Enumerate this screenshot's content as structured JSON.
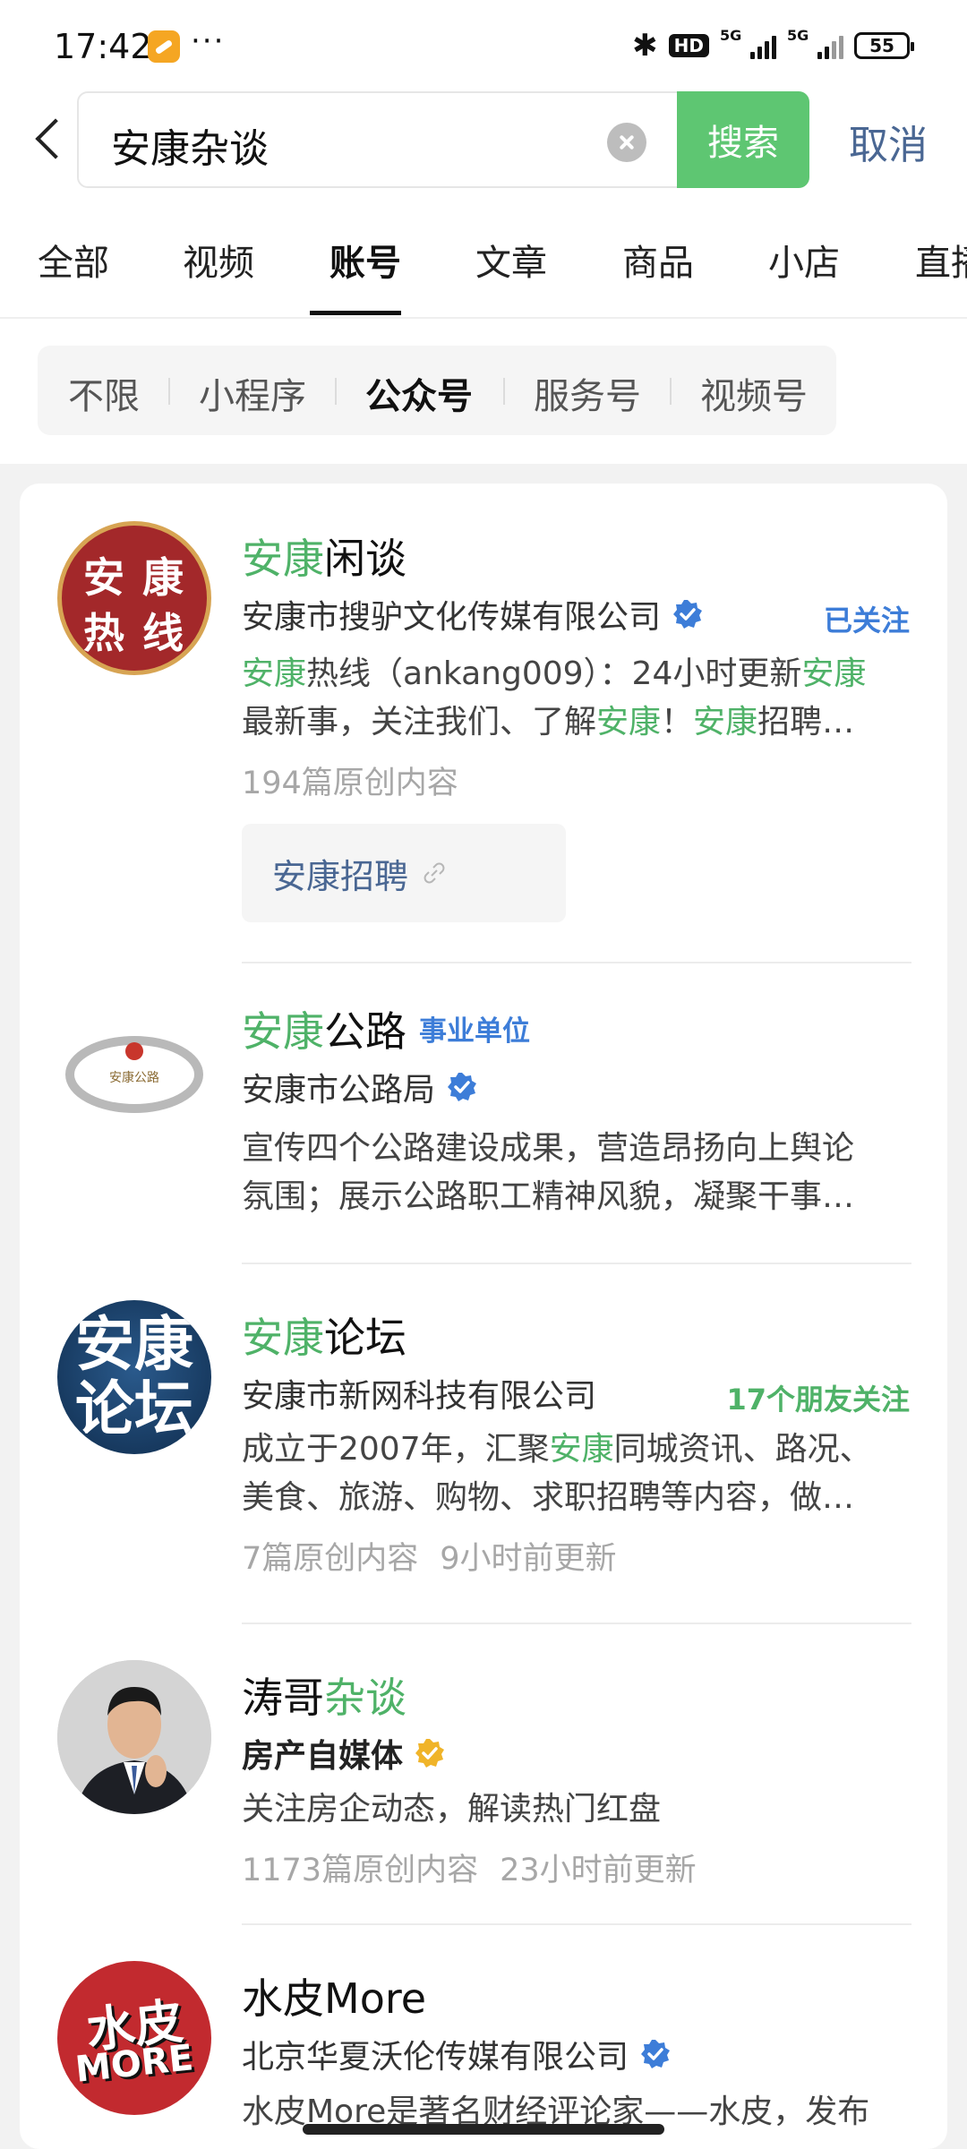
{
  "status_bar": {
    "time": "17:42",
    "dots": "···",
    "bluetooth_glyph": "✱",
    "hd_label": "HD",
    "signal1_label": "5G",
    "signal2_label": "5G",
    "battery": "55"
  },
  "search": {
    "query": "安康杂谈",
    "button_label": "搜索",
    "cancel_label": "取消"
  },
  "tabs": [
    "全部",
    "视频",
    "账号",
    "文章",
    "商品",
    "小店",
    "直播"
  ],
  "active_tab": "账号",
  "filters": [
    "不限",
    "小程序",
    "公众号",
    "服务号",
    "视频号"
  ],
  "active_filter": "公众号",
  "results": [
    {
      "name_hl": "安康",
      "name_rest": "闲谈",
      "avatar_text_1": "安 康",
      "avatar_text_2": "热 线",
      "org": "安康市搜驴文化传媒有限公司",
      "side_link": "已关注",
      "desc_line1": [
        {
          "t": "安康",
          "hl": true
        },
        {
          "t": "热线（ankang009）：24小时更新",
          "hl": false
        },
        {
          "t": "安康",
          "hl": true
        }
      ],
      "desc_line2": [
        {
          "t": "最新事，关注我们、了解",
          "hl": false
        },
        {
          "t": "安康",
          "hl": true
        },
        {
          "t": "！",
          "hl": false
        },
        {
          "t": "安康",
          "hl": true
        },
        {
          "t": "招聘…",
          "hl": false
        }
      ],
      "meta": [
        "194篇原创内容"
      ],
      "link_card": "安康招聘"
    },
    {
      "name_hl": "安康",
      "name_rest": "公路",
      "tag": "事业单位",
      "avatar_text_1": "安康公路",
      "org": "安康市公路局",
      "desc_line1": [
        {
          "t": "宣传四个公路建设成果，营造昂扬向上舆论",
          "hl": false
        }
      ],
      "desc_line2": [
        {
          "t": "氛围；展示公路职工精神风貌，凝聚干事…",
          "hl": false
        }
      ]
    },
    {
      "name_hl": "安康",
      "name_rest": "论坛",
      "avatar_text_1": "安康",
      "avatar_text_2": "论坛",
      "org": "安康市新网科技有限公司",
      "side_link": "17个朋友关注",
      "desc_line1": [
        {
          "t": "成立于2007年，汇聚",
          "hl": false
        },
        {
          "t": "安康",
          "hl": true
        },
        {
          "t": "同城资讯、路况、",
          "hl": false
        }
      ],
      "desc_line2": [
        {
          "t": "美食、旅游、购物、求职招聘等内容，做…",
          "hl": false
        }
      ],
      "meta": [
        "7篇原创内容",
        "9小时前更新"
      ]
    },
    {
      "name_plain": "涛哥",
      "name_hl": "杂谈",
      "org": "房产自媒体",
      "desc_line1": [
        {
          "t": "关注房企动态，解读热门红盘",
          "hl": false
        }
      ],
      "meta": [
        "1173篇原创内容",
        "23小时前更新"
      ]
    },
    {
      "name_plain": "水皮More",
      "avatar_text_1": "水皮",
      "avatar_text_2": "MORE",
      "org": "北京华夏沃伦传媒有限公司",
      "desc_line1": [
        {
          "t": "水皮More是著名财经评论家——水皮，发布",
          "hl": false
        }
      ]
    }
  ],
  "colors": {
    "accent_green": "#5ec672",
    "highlight_green": "#4fb268",
    "link_blue": "#4a6793",
    "verify_blue": "#3d7dd8",
    "verify_gold": "#f0b429"
  }
}
